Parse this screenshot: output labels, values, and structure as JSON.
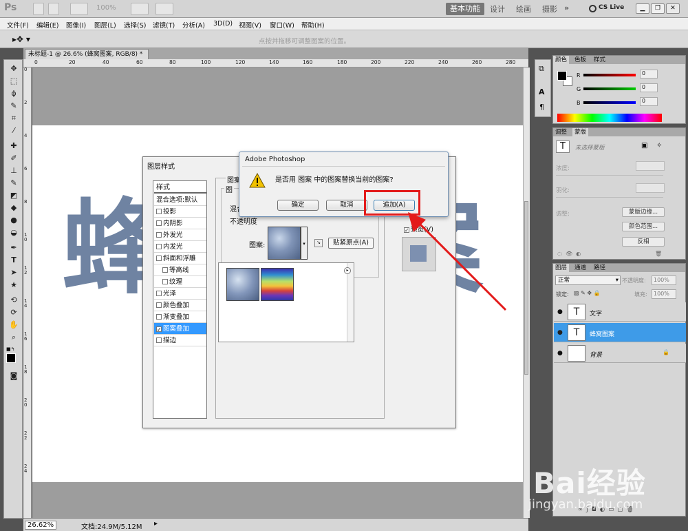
{
  "app": {
    "logo": "Ps",
    "zoom_display": "100%",
    "workspaces": [
      "基本功能",
      "设计",
      "绘画",
      "摄影"
    ],
    "cslive": "CS Live"
  },
  "menu": [
    "文件(F)",
    "编辑(E)",
    "图像(I)",
    "图层(L)",
    "选择(S)",
    "滤镜(T)",
    "分析(A)",
    "3D(D)",
    "视图(V)",
    "窗口(W)",
    "帮助(H)"
  ],
  "options": {
    "hint": "点按并拖移可调整图案的位置。"
  },
  "document": {
    "tab": "未标题-1 @ 26.6% (蜂窝图案, RGB/8) *",
    "ruler_top": [
      "0",
      "20",
      "40",
      "60",
      "80",
      "100",
      "120",
      "140",
      "160",
      "180",
      "200",
      "220",
      "240",
      "260",
      "280"
    ],
    "ruler_left": [
      "0",
      "2",
      "4",
      "6",
      "8",
      "10",
      "12",
      "14",
      "16",
      "18",
      "20",
      "22",
      "24"
    ],
    "canvas_text": "蜂窝图案"
  },
  "status": {
    "zoom": "26.62%",
    "doc": "文档:24.9M/5.12M"
  },
  "layer_style": {
    "title": "图层样式",
    "header": "样式",
    "items": [
      {
        "label": "混合选项:默认",
        "checkbox": false
      },
      {
        "label": "投影",
        "checkbox": true,
        "checked": false
      },
      {
        "label": "内阴影",
        "checkbox": true,
        "checked": false
      },
      {
        "label": "外发光",
        "checkbox": true,
        "checked": false
      },
      {
        "label": "内发光",
        "checkbox": true,
        "checked": false
      },
      {
        "label": "斜面和浮雕",
        "checkbox": true,
        "checked": false
      },
      {
        "label": "等高线",
        "checkbox": true,
        "checked": false,
        "indent": true
      },
      {
        "label": "纹理",
        "checkbox": true,
        "checked": false,
        "indent": true
      },
      {
        "label": "光泽",
        "checkbox": true,
        "checked": false
      },
      {
        "label": "颜色叠加",
        "checkbox": true,
        "checked": false
      },
      {
        "label": "渐变叠加",
        "checkbox": true,
        "checked": false
      },
      {
        "label": "图案叠加",
        "checkbox": true,
        "checked": true,
        "selected": true
      },
      {
        "label": "描边",
        "checkbox": true,
        "checked": false
      }
    ],
    "group_title": "图案",
    "group_sub": "图",
    "blend_label": "混合",
    "opacity_label": "不透明度",
    "pattern_label": "图案:",
    "snap_button": "贴紧原点(A)",
    "preview_label": "预览(V)"
  },
  "alert": {
    "title": "Adobe Photoshop",
    "message": "是否用 图案 中的图案替换当前的图案?",
    "ok": "确定",
    "cancel": "取消",
    "append": "追加(A)"
  },
  "color_panel": {
    "tabs": [
      "颜色",
      "色板",
      "样式"
    ],
    "channels": [
      {
        "name": "R",
        "value": "0"
      },
      {
        "name": "G",
        "value": "0"
      },
      {
        "name": "B",
        "value": "0"
      }
    ]
  },
  "adjust_panel": {
    "tabs": [
      "调整",
      "蒙版"
    ],
    "no_selection": "未选择蒙版",
    "density": "浓度:",
    "feather": "羽化:",
    "refine": "调整:",
    "btn_edge": "蒙版边缘...",
    "btn_range": "颜色范围...",
    "btn_invert": "反相"
  },
  "layers_panel": {
    "tabs": [
      "图层",
      "通道",
      "路径"
    ],
    "blend_mode": "正常",
    "opacity_label": "不透明度:",
    "opacity": "100%",
    "lock_label": "锁定:",
    "fill_label": "填充:",
    "fill": "100%",
    "layers": [
      {
        "name": "文字",
        "type": "T"
      },
      {
        "name": "蜂窝图案",
        "type": "T",
        "selected": true
      },
      {
        "name": "背景",
        "type": "bg"
      }
    ]
  },
  "watermark": {
    "brand": "Bai经验",
    "url": "jingyan.baidu.com"
  },
  "colors": {
    "highlight": "#e31b1b",
    "selection": "#3e9be8"
  }
}
